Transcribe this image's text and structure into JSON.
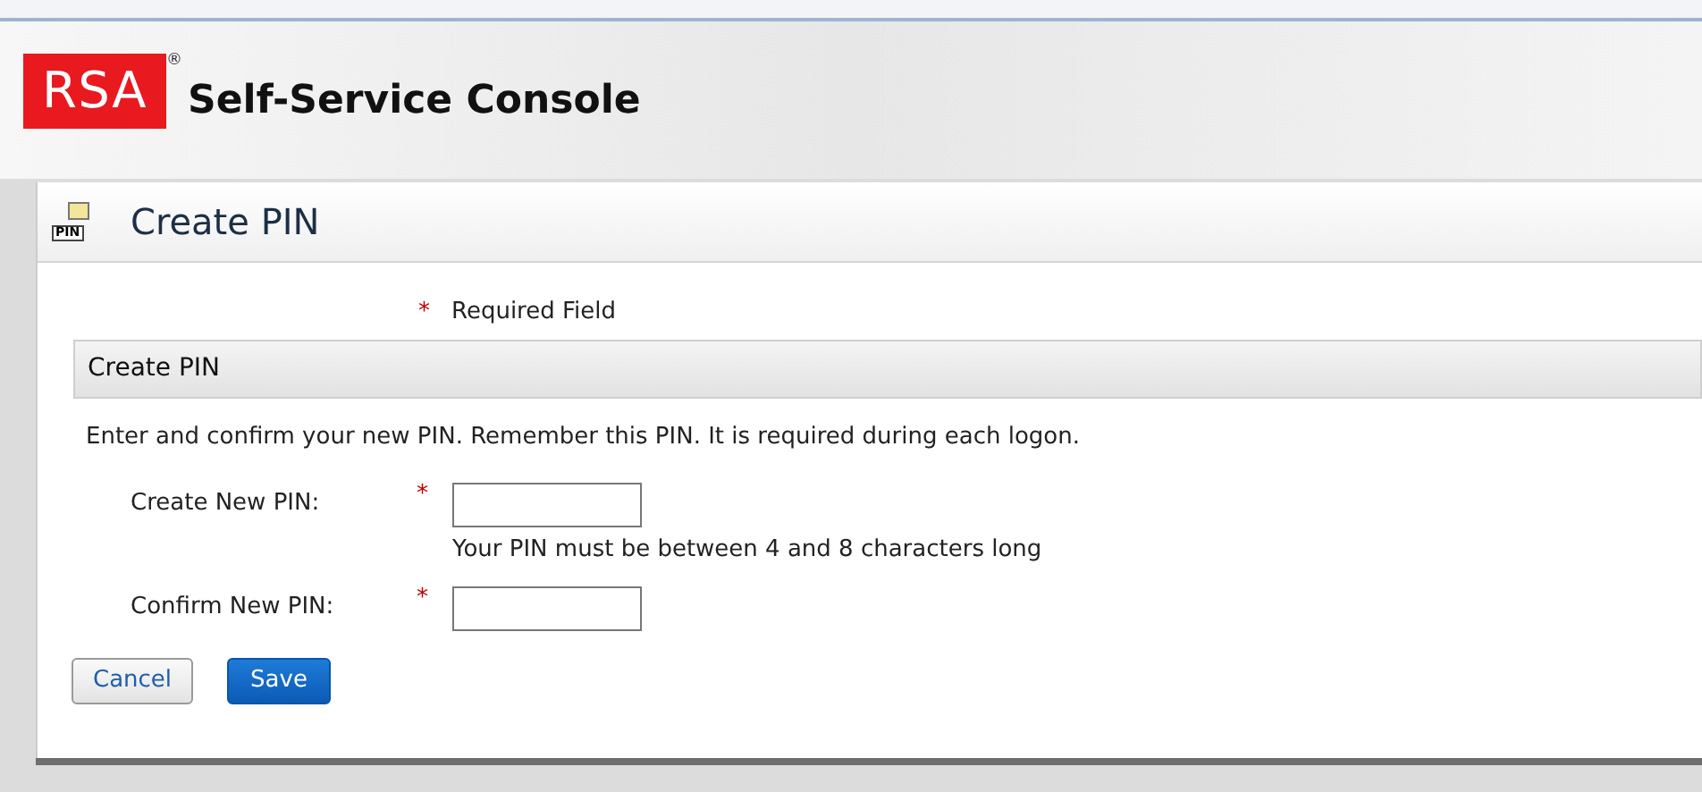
{
  "header": {
    "logo": "RSA",
    "logo_mark": "®",
    "title": "Self-Service Console"
  },
  "panel": {
    "icon_label": "PIN",
    "title": "Create PIN"
  },
  "required_note": {
    "mark": "*",
    "text": "Required Field"
  },
  "section": {
    "title": "Create PIN",
    "intro": "Enter and confirm your new PIN. Remember this PIN. It is required during each logon."
  },
  "fields": [
    {
      "label": "Create New PIN:",
      "required": true,
      "hint": "Your PIN must be between 4 and 8 characters long"
    },
    {
      "label": "Confirm New PIN:",
      "required": true
    }
  ],
  "required_mark": "*",
  "buttons": [
    {
      "label": "Cancel",
      "kind": "secondary"
    },
    {
      "label": "Save",
      "kind": "primary"
    }
  ]
}
